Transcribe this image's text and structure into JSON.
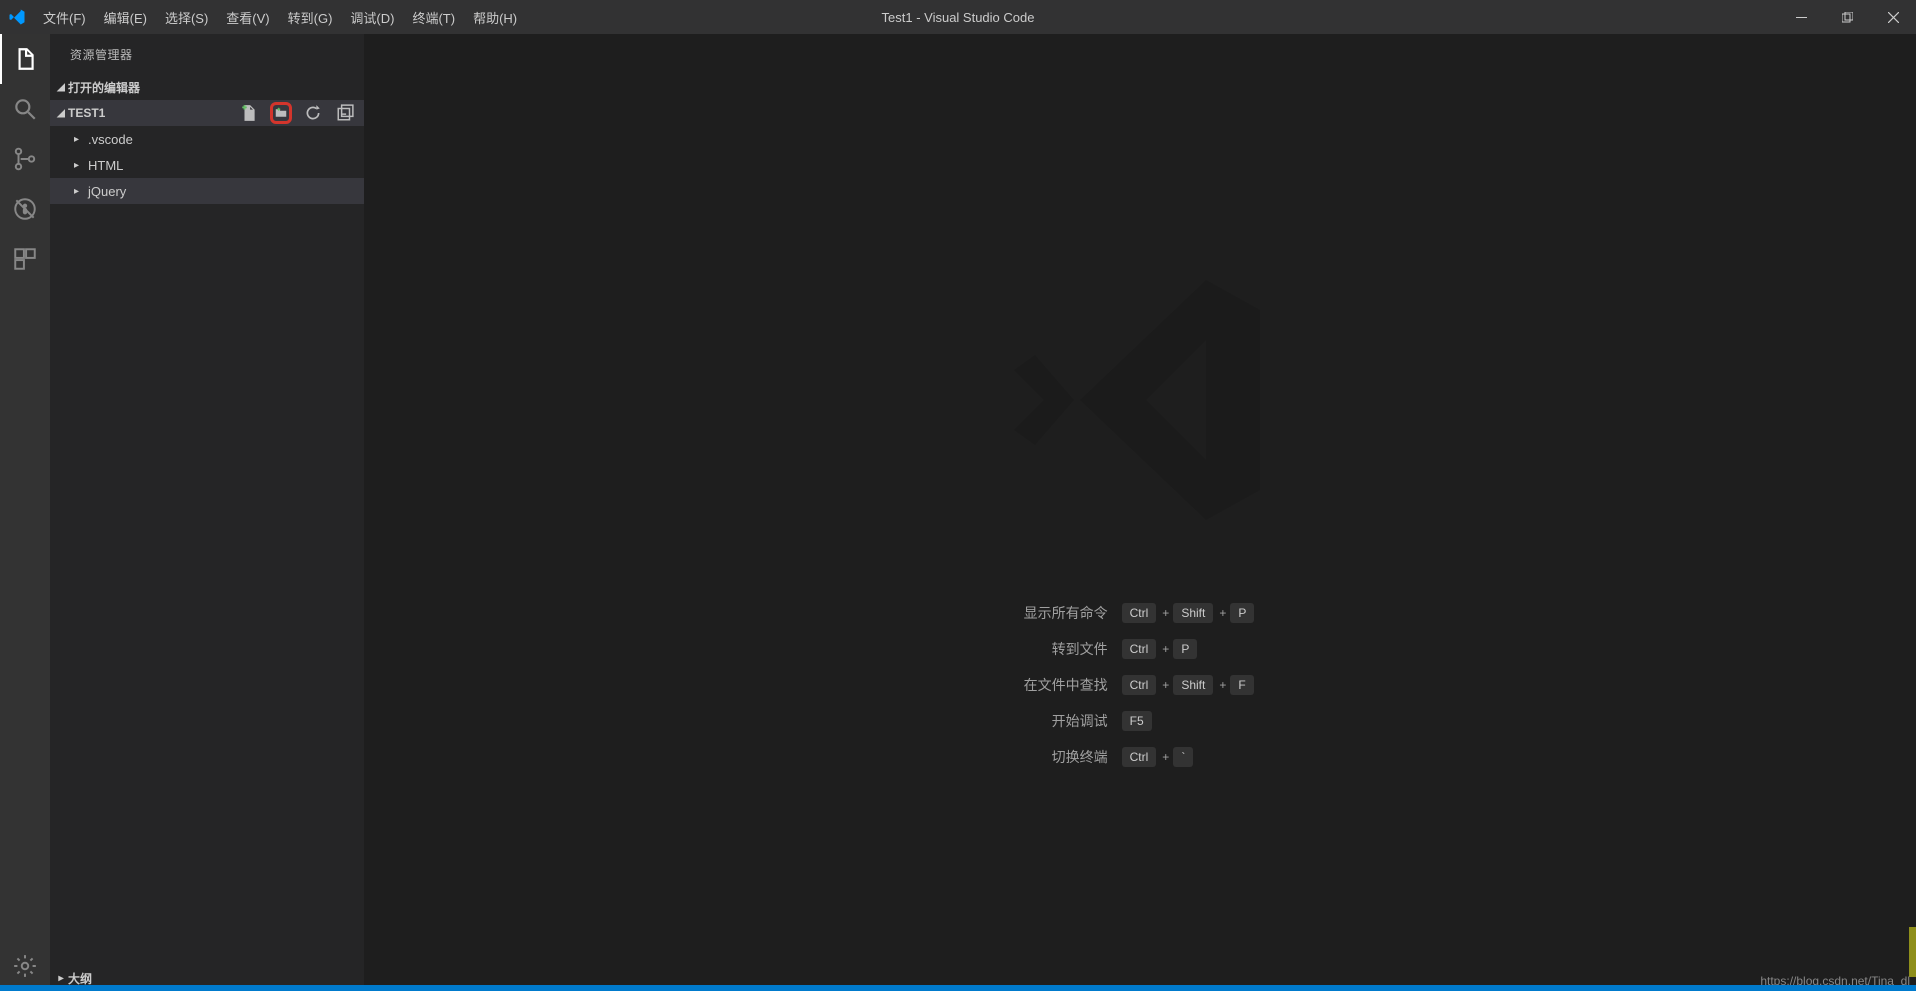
{
  "title": "Test1 - Visual Studio Code",
  "menu": [
    {
      "label": "文件(F)"
    },
    {
      "label": "编辑(E)"
    },
    {
      "label": "选择(S)"
    },
    {
      "label": "查看(V)"
    },
    {
      "label": "转到(G)"
    },
    {
      "label": "调试(D)"
    },
    {
      "label": "终端(T)"
    },
    {
      "label": "帮助(H)"
    }
  ],
  "sidebar": {
    "title": "资源管理器",
    "open_editors_label": "打开的编辑器",
    "project_name": "TEST1",
    "outline_label": "大纲",
    "tree": [
      {
        "label": ".vscode"
      },
      {
        "label": "HTML"
      },
      {
        "label": "jQuery"
      }
    ]
  },
  "shortcuts": [
    {
      "label": "显示所有命令",
      "keys": [
        "Ctrl",
        "Shift",
        "P"
      ]
    },
    {
      "label": "转到文件",
      "keys": [
        "Ctrl",
        "P"
      ]
    },
    {
      "label": "在文件中查找",
      "keys": [
        "Ctrl",
        "Shift",
        "F"
      ]
    },
    {
      "label": "开始调试",
      "keys": [
        "F5"
      ]
    },
    {
      "label": "切换终端",
      "keys": [
        "Ctrl",
        "`"
      ]
    }
  ],
  "watermark_url": "https://blog.csdn.net/Tina_dl"
}
